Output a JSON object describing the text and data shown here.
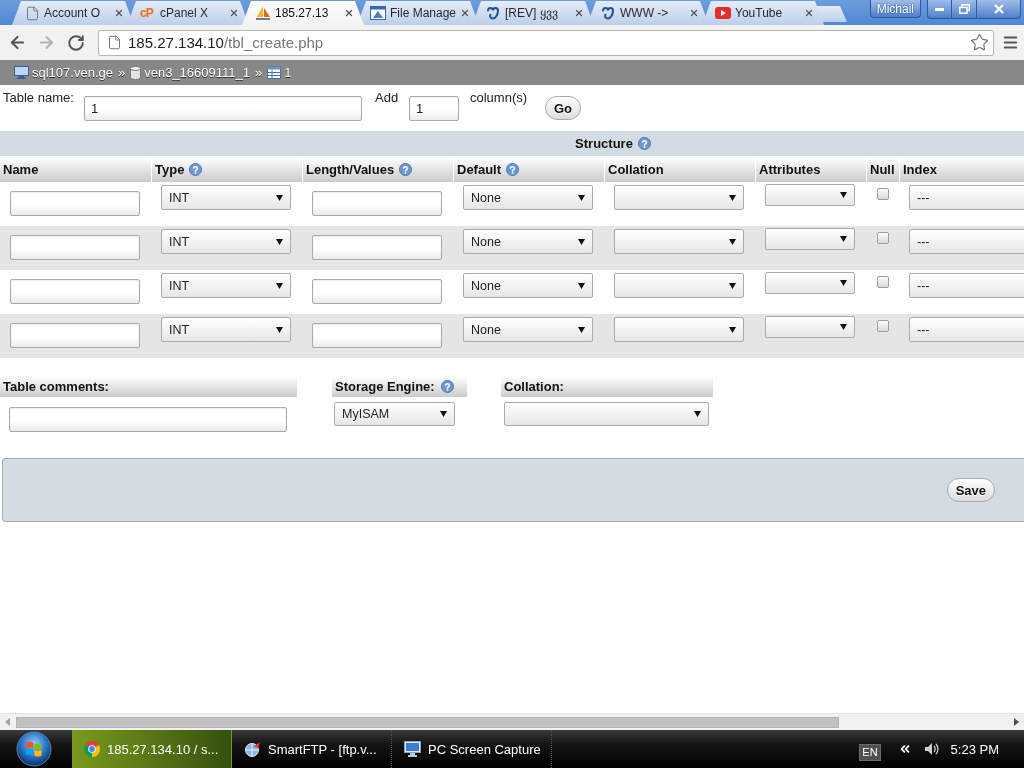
{
  "browser": {
    "tabs": [
      {
        "kind": "document",
        "label": "Account O",
        "selected": false
      },
      {
        "kind": "cpanel",
        "icon_text": "cP",
        "label": "cPanel X",
        "selected": false
      },
      {
        "kind": "pma",
        "label": "185.27.13",
        "selected": true
      },
      {
        "kind": "filemanager",
        "label": "File Manage",
        "selected": false
      },
      {
        "kind": "site",
        "label": "[REV] ყვვ",
        "selected": false
      },
      {
        "kind": "site",
        "label": "WWW ->",
        "selected": false
      },
      {
        "kind": "youtube",
        "label": "YouTube",
        "selected": false
      }
    ],
    "profile": "Michail",
    "address": {
      "host": "185.27.134.10",
      "path": "/tbl_create.php"
    }
  },
  "breadcrumb": [
    {
      "kind": "server",
      "label": "sql107.ven.ge"
    },
    {
      "kind": "separator",
      "label": "»"
    },
    {
      "kind": "database",
      "label": "ven3_16609111_1"
    },
    {
      "kind": "separator",
      "label": "»"
    },
    {
      "kind": "table",
      "label": "1"
    }
  ],
  "create_form": {
    "name_label": "Table name:",
    "name_value": "1",
    "add_label": "Add",
    "add_value": "1",
    "add_suffix": "column(s)",
    "go_button": "Go"
  },
  "structure": {
    "title": "Structure",
    "title_help": true,
    "columns": [
      {
        "label": "Name",
        "help": false
      },
      {
        "label": "Type",
        "help": true
      },
      {
        "label": "Length/Values",
        "help": true
      },
      {
        "label": "Default",
        "help": true
      },
      {
        "label": "Collation",
        "help": false
      },
      {
        "label": "Attributes",
        "help": false
      },
      {
        "label": "Null",
        "help": false
      },
      {
        "label": "Index",
        "help": false
      }
    ],
    "rows": [
      {
        "type": "INT",
        "default": "None",
        "null": false,
        "index": "---"
      },
      {
        "type": "INT",
        "default": "None",
        "null": false,
        "index": "---"
      },
      {
        "type": "INT",
        "default": "None",
        "null": false,
        "index": "---"
      },
      {
        "type": "INT",
        "default": "None",
        "null": false,
        "index": "---"
      }
    ]
  },
  "options": [
    {
      "kind": "text",
      "label": "Table comments:",
      "help": false
    },
    {
      "kind": "select",
      "label": "Storage Engine:",
      "help": true,
      "value": "MyISAM"
    },
    {
      "kind": "select",
      "label": "Collation:",
      "help": false
    }
  ],
  "save_button": "Save",
  "taskbar": {
    "items": [
      {
        "kind": "chrome",
        "label": "185.27.134.10 / s...",
        "selected": true
      },
      {
        "kind": "ftp",
        "label": "SmartFTP - [ftp.v...",
        "selected": false
      },
      {
        "kind": "capture",
        "label": "PC Screen Capture",
        "selected": false
      }
    ],
    "language": "EN",
    "clock": "5:23 PM"
  }
}
